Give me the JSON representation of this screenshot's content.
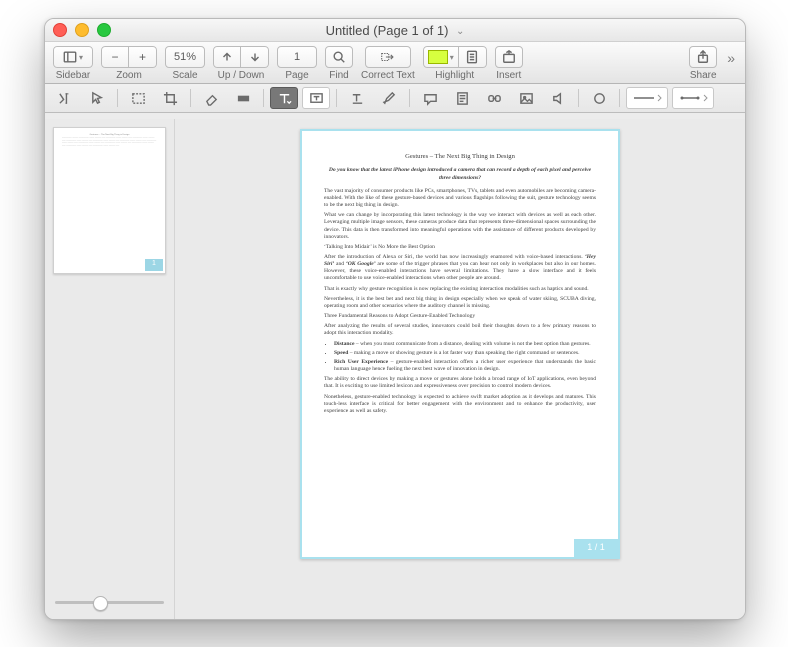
{
  "titlebar": {
    "title": "Untitled (Page 1 of 1)"
  },
  "toolbar": {
    "sidebar_label": "Sidebar",
    "zoom_label": "Zoom",
    "zoom_out": "−",
    "zoom_in": "+",
    "scale_label": "Scale",
    "scale_value": "51%",
    "updown_label": "Up / Down",
    "page_label": "Page",
    "page_value": "1",
    "find_label": "Find",
    "correct_label": "Correct Text",
    "highlight_label": "Highlight",
    "highlight_color": "#d7ff3f",
    "insert_label": "Insert",
    "share_label": "Share"
  },
  "page_indicator": "1 / 1",
  "thumb_indicator": "1",
  "document": {
    "heading": "Gestures – The Next Big Thing in Design",
    "lead": "Do you know that the latest iPhone design introduced a camera that can record a depth of each pixel and perceive three dimensions?",
    "p1": "The vast majority of consumer products like PCs, smartphones, TVs, tablets and even automobiles are becoming camera-enabled. With the like of these gesture-based devices and various flagships following the suit, gesture technology seems to be the next big thing in design.",
    "p2a": "What we can change by incorporating this latest technology is the way we interact with devices as well as each other. Leveraging multiple image sensors, these cameras produce data that represents three-dimensional spaces surrounding the device. This data is then transformed into meaningful operations with the assistance of different products developed by innovators.",
    "sub1": "‘Talking Into Midair’ is No More the Best Option",
    "p3": "After the introduction of Alexa or Siri, the world has now increasingly enamored with voice-based interactions. ‘Hey Siri’ and ‘OK Google’ are some of the trigger phrases that you can hear not only in workplaces but also in our homes. However, these voice-enabled interactions have several limitations. They have a slow interface and it feels uncomfortable to use voice-enabled interactions when other people are around.",
    "p4": "That is exactly why gesture recognition is now replacing the existing interaction modalities such as haptics and sound.",
    "p5": "Nevertheless, it is the best bet and next big thing in design especially when we speak of water skiing, SCUBA diving, operating room and other scenarios where the auditory channel is missing.",
    "sub2": "Three Fundamental Reasons to Adopt Gesture-Enabled Technology",
    "p6": "After analyzing the results of several studies, innovators could boil their thoughts down to a few primary reasons to adopt this interaction modality.",
    "bullets": [
      {
        "term": "Distance",
        "text": " – when you must communicate from a distance, dealing with volume is not the best option than gestures."
      },
      {
        "term": "Speed",
        "text": " – making a move or showing gesture is a lot faster way than speaking the right command or sentences."
      },
      {
        "term": "Rich User Experience",
        "text": " – gesture-enabled interaction offers a richer user experience that understands the basic human language hence fueling the next best wave of innovation in design."
      }
    ],
    "p7": "The ability to direct devices by making a move or gestures alone holds a broad range of IoT applications, even beyond that. It is exciting to use limited lexicon and expressiveness over precision to control modern devices.",
    "p8": "Nonetheless, gesture-enabled technology is expected to achieve swift market adoption as it develops and matures. This touch-less interface is critical for better engagement with the environment and to enhance the productivity, user experience as well as safety."
  }
}
